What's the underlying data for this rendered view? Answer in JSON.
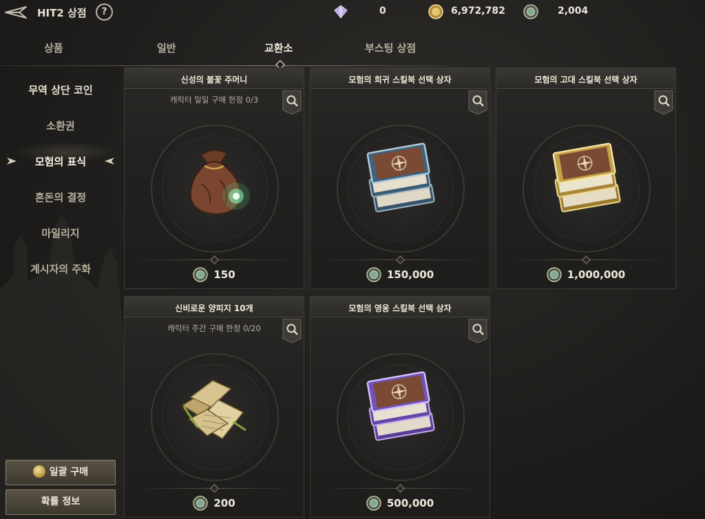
{
  "header": {
    "title": "HIT2 상점",
    "help_label": "?",
    "currencies": [
      {
        "icon": "diamond-icon",
        "value": "0"
      },
      {
        "icon": "gold-coin-icon",
        "value": "6,972,782"
      },
      {
        "icon": "exchange-coin-icon",
        "value": "2,004"
      }
    ]
  },
  "tabs": [
    {
      "label": "상품",
      "active": false
    },
    {
      "label": "일반",
      "active": false
    },
    {
      "label": "교환소",
      "active": true
    },
    {
      "label": "부스팅 상점",
      "active": false
    }
  ],
  "sidebar": {
    "items": [
      {
        "label": "무역 상단 코인"
      },
      {
        "label": "소환권"
      },
      {
        "label": "모험의 표식",
        "active": true
      },
      {
        "label": "혼돈의 결정"
      },
      {
        "label": "마일리지"
      },
      {
        "label": "계시자의 주화"
      }
    ],
    "bulk_buy_label": "일괄 구매",
    "probability_label": "확률 정보"
  },
  "cards": [
    {
      "title": "신성의 불꽃 주머니",
      "limit": "캐릭터 일일 구매 한정 0/3",
      "price": "150",
      "art": "pouch-icon"
    },
    {
      "title": "모험의 희귀 스킬북 선택 상자",
      "limit": "",
      "price": "150,000",
      "art": "blue-skillbook-icon"
    },
    {
      "title": "모험의 고대 스킬북 선택 상자",
      "limit": "",
      "price": "1,000,000",
      "art": "gold-skillbook-icon"
    },
    {
      "title": "신비로운 양피지 10개",
      "limit": "캐릭터 주간 구매 한정 0/20",
      "price": "200",
      "art": "parchment-icon"
    },
    {
      "title": "모험의 영웅 스킬북 선택 상자",
      "limit": "",
      "price": "500,000",
      "art": "purple-skillbook-icon"
    }
  ],
  "colors": {
    "accent_gold": "#c9a85a",
    "text_primary": "#f0ead9",
    "background": "#1f1e1c"
  }
}
